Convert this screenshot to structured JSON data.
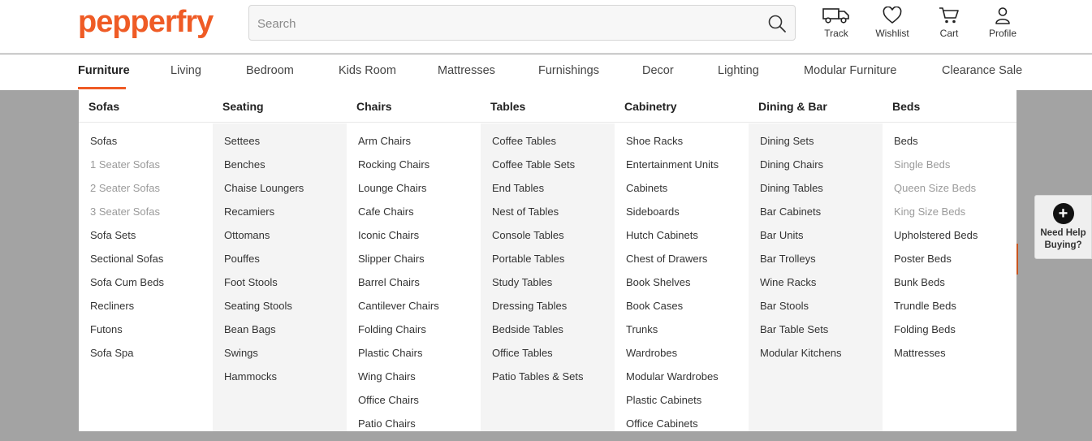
{
  "brand": {
    "logo_text": "pepperfry",
    "accent": "#ef5b25"
  },
  "search": {
    "placeholder": "Search",
    "value": ""
  },
  "actions": [
    {
      "label": "Track",
      "icon": "truck-icon"
    },
    {
      "label": "Wishlist",
      "icon": "heart-icon"
    },
    {
      "label": "Cart",
      "icon": "cart-icon"
    },
    {
      "label": "Profile",
      "icon": "user-icon"
    }
  ],
  "nav": [
    {
      "label": "Furniture",
      "active": true
    },
    {
      "label": "Living"
    },
    {
      "label": "Bedroom"
    },
    {
      "label": "Kids Room"
    },
    {
      "label": "Mattresses"
    },
    {
      "label": "Furnishings"
    },
    {
      "label": "Decor"
    },
    {
      "label": "Lighting"
    },
    {
      "label": "Modular Furniture"
    },
    {
      "label": "Clearance Sale"
    }
  ],
  "menu": {
    "columns": [
      {
        "title": "Sofas",
        "items": [
          {
            "label": "Sofas"
          },
          {
            "label": "1 Seater Sofas",
            "sub": true
          },
          {
            "label": "2 Seater Sofas",
            "sub": true
          },
          {
            "label": "3 Seater Sofas",
            "sub": true
          },
          {
            "label": "Sofa Sets"
          },
          {
            "label": "Sectional Sofas"
          },
          {
            "label": "Sofa Cum Beds"
          },
          {
            "label": "Recliners"
          },
          {
            "label": "Futons"
          },
          {
            "label": "Sofa Spa"
          }
        ]
      },
      {
        "title": "Seating",
        "items": [
          {
            "label": "Settees"
          },
          {
            "label": "Benches"
          },
          {
            "label": "Chaise Loungers"
          },
          {
            "label": "Recamiers"
          },
          {
            "label": "Ottomans"
          },
          {
            "label": "Pouffes"
          },
          {
            "label": "Foot Stools"
          },
          {
            "label": "Seating Stools"
          },
          {
            "label": "Bean Bags"
          },
          {
            "label": "Swings"
          },
          {
            "label": "Hammocks"
          }
        ]
      },
      {
        "title": "Chairs",
        "items": [
          {
            "label": "Arm Chairs"
          },
          {
            "label": "Rocking Chairs"
          },
          {
            "label": "Lounge Chairs"
          },
          {
            "label": "Cafe Chairs"
          },
          {
            "label": "Iconic Chairs"
          },
          {
            "label": "Slipper Chairs"
          },
          {
            "label": "Barrel Chairs"
          },
          {
            "label": "Cantilever Chairs"
          },
          {
            "label": "Folding Chairs"
          },
          {
            "label": "Plastic Chairs"
          },
          {
            "label": "Wing Chairs"
          },
          {
            "label": "Office Chairs"
          },
          {
            "label": "Patio Chairs"
          }
        ]
      },
      {
        "title": "Tables",
        "items": [
          {
            "label": "Coffee Tables"
          },
          {
            "label": "Coffee Table Sets"
          },
          {
            "label": "End Tables"
          },
          {
            "label": "Nest of Tables"
          },
          {
            "label": "Console Tables"
          },
          {
            "label": "Portable Tables"
          },
          {
            "label": "Study Tables"
          },
          {
            "label": "Dressing Tables"
          },
          {
            "label": "Bedside Tables"
          },
          {
            "label": "Office Tables"
          },
          {
            "label": "Patio Tables & Sets"
          }
        ]
      },
      {
        "title": "Cabinetry",
        "items": [
          {
            "label": "Shoe Racks"
          },
          {
            "label": "Entertainment Units"
          },
          {
            "label": "Cabinets"
          },
          {
            "label": "Sideboards"
          },
          {
            "label": "Hutch Cabinets"
          },
          {
            "label": "Chest of Drawers"
          },
          {
            "label": "Book Shelves"
          },
          {
            "label": "Book Cases"
          },
          {
            "label": "Trunks"
          },
          {
            "label": "Wardrobes"
          },
          {
            "label": "Modular Wardrobes"
          },
          {
            "label": "Plastic Cabinets"
          },
          {
            "label": "Office Cabinets"
          }
        ]
      },
      {
        "title": "Dining & Bar",
        "items": [
          {
            "label": "Dining Sets"
          },
          {
            "label": "Dining Chairs"
          },
          {
            "label": "Dining Tables"
          },
          {
            "label": "Bar Cabinets"
          },
          {
            "label": "Bar Units"
          },
          {
            "label": "Bar Trolleys"
          },
          {
            "label": "Wine Racks"
          },
          {
            "label": "Bar Stools"
          },
          {
            "label": "Bar Table Sets"
          },
          {
            "label": "Modular Kitchens"
          }
        ]
      },
      {
        "title": "Beds",
        "items": [
          {
            "label": "Beds"
          },
          {
            "label": "Single Beds",
            "sub": true
          },
          {
            "label": "Queen Size Beds",
            "sub": true
          },
          {
            "label": "King Size Beds",
            "sub": true
          },
          {
            "label": "Upholstered Beds"
          },
          {
            "label": "Poster Beds"
          },
          {
            "label": "Bunk Beds"
          },
          {
            "label": "Trundle Beds"
          },
          {
            "label": "Folding Beds"
          },
          {
            "label": "Mattresses"
          }
        ]
      }
    ]
  },
  "help": {
    "line1": "Need Help",
    "line2": "Buying?",
    "icon": "plus-icon"
  }
}
